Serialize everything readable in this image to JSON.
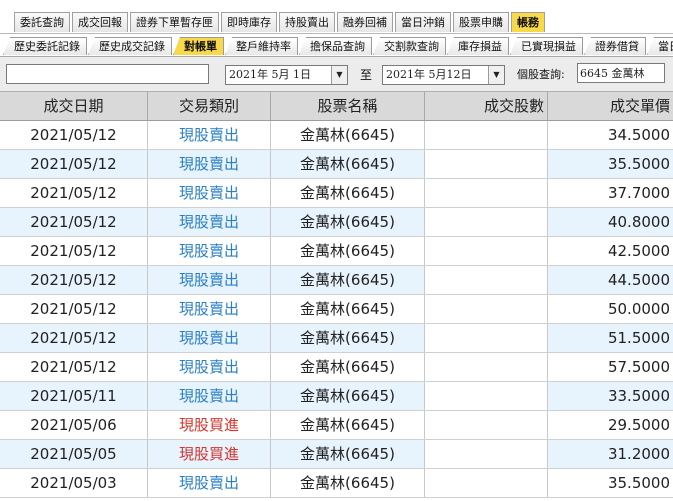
{
  "top_tabs": [
    "委託查詢",
    "成交回報",
    "證券下單暫存匣",
    "即時庫存",
    "持股賣出",
    "融券回補",
    "當日沖銷",
    "股票申購",
    "帳務"
  ],
  "top_tabs_active": 8,
  "sub_tabs": [
    "歷史委託記錄",
    "歷史成交記錄",
    "對帳單",
    "整戶維持率",
    "擔保品查詢",
    "交割款查詢",
    "庫存損益",
    "已實現損益",
    "證券借貸",
    "當日沖"
  ],
  "sub_tabs_active": 2,
  "query": {
    "account_value": "",
    "date_from": "2021年  5月  1日",
    "to_label": "至",
    "date_to": "2021年  5月12日",
    "stock_label": "個股查詢:",
    "stock_value": "6645 金萬林"
  },
  "table": {
    "headers": [
      "成交日期",
      "交易類別",
      "股票名稱",
      "成交股數",
      "成交單價"
    ],
    "rows": [
      {
        "date": "2021/05/12",
        "type": "現股賣出",
        "side": "sell",
        "name": "金萬林(6645)",
        "qty": "",
        "price": "34.5000"
      },
      {
        "date": "2021/05/12",
        "type": "現股賣出",
        "side": "sell",
        "name": "金萬林(6645)",
        "qty": "",
        "price": "35.5000"
      },
      {
        "date": "2021/05/12",
        "type": "現股賣出",
        "side": "sell",
        "name": "金萬林(6645)",
        "qty": "",
        "price": "37.7000"
      },
      {
        "date": "2021/05/12",
        "type": "現股賣出",
        "side": "sell",
        "name": "金萬林(6645)",
        "qty": "",
        "price": "40.8000"
      },
      {
        "date": "2021/05/12",
        "type": "現股賣出",
        "side": "sell",
        "name": "金萬林(6645)",
        "qty": "",
        "price": "42.5000"
      },
      {
        "date": "2021/05/12",
        "type": "現股賣出",
        "side": "sell",
        "name": "金萬林(6645)",
        "qty": "",
        "price": "44.5000"
      },
      {
        "date": "2021/05/12",
        "type": "現股賣出",
        "side": "sell",
        "name": "金萬林(6645)",
        "qty": "",
        "price": "50.0000"
      },
      {
        "date": "2021/05/12",
        "type": "現股賣出",
        "side": "sell",
        "name": "金萬林(6645)",
        "qty": "",
        "price": "51.5000"
      },
      {
        "date": "2021/05/12",
        "type": "現股賣出",
        "side": "sell",
        "name": "金萬林(6645)",
        "qty": "",
        "price": "57.5000"
      },
      {
        "date": "2021/05/11",
        "type": "現股賣出",
        "side": "sell",
        "name": "金萬林(6645)",
        "qty": "",
        "price": "33.5000"
      },
      {
        "date": "2021/05/06",
        "type": "現股買進",
        "side": "buy",
        "name": "金萬林(6645)",
        "qty": "",
        "price": "29.5000"
      },
      {
        "date": "2021/05/05",
        "type": "現股買進",
        "side": "buy",
        "name": "金萬林(6645)",
        "qty": "",
        "price": "31.2000"
      },
      {
        "date": "2021/05/03",
        "type": "現股賣出",
        "side": "sell",
        "name": "金萬林(6645)",
        "qty": "",
        "price": "35.5000"
      }
    ]
  },
  "colors": {
    "sell": "#2a7fc4",
    "buy": "#d2362d",
    "active_tab": "#f7d94a",
    "row_alt": "#e7f3fd"
  }
}
